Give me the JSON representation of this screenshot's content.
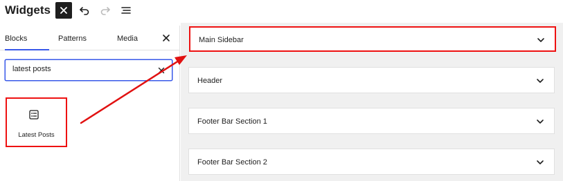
{
  "header": {
    "title": "Widgets"
  },
  "sidebar": {
    "tabs": [
      "Blocks",
      "Patterns",
      "Media"
    ],
    "search": {
      "value": "latest posts"
    },
    "result": {
      "label": "Latest Posts",
      "icon": "latest-posts-icon"
    }
  },
  "widget_areas": [
    {
      "title": "Main Sidebar"
    },
    {
      "title": "Header"
    },
    {
      "title": "Footer Bar Section 1"
    },
    {
      "title": "Footer Bar Section 2"
    }
  ],
  "colors": {
    "accent": "#3858e9",
    "annotation": "#e11111",
    "dark": "#1e1e1e",
    "canvas": "#f0f0f0"
  }
}
